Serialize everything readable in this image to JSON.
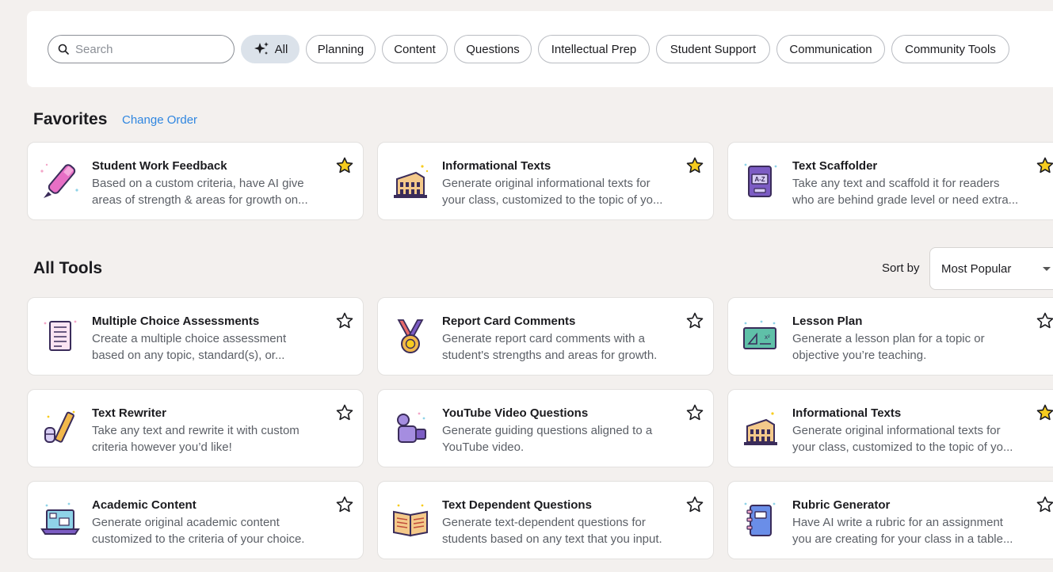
{
  "search": {
    "placeholder": "Search"
  },
  "filters": [
    {
      "label": "All",
      "active": true
    },
    {
      "label": "Planning"
    },
    {
      "label": "Content"
    },
    {
      "label": "Questions"
    },
    {
      "label": "Intellectual Prep"
    },
    {
      "label": "Student Support"
    },
    {
      "label": "Communication"
    },
    {
      "label": "Community Tools"
    }
  ],
  "favorites": {
    "title": "Favorites",
    "change_order": "Change Order",
    "cards": [
      {
        "title": "Student Work Feedback",
        "desc": "Based on a custom criteria, have AI give areas of strength & areas for growth on...",
        "icon": "pen-icon",
        "starred": true
      },
      {
        "title": "Informational Texts",
        "desc": "Generate original informational texts for your class, customized to the topic of yo...",
        "icon": "colosseum-icon",
        "starred": true
      },
      {
        "title": "Text Scaffolder",
        "desc": "Take any text and scaffold it for readers who are behind grade level or need extra...",
        "icon": "dictionary-icon",
        "starred": true
      }
    ]
  },
  "all_tools": {
    "title": "All Tools",
    "sort_label": "Sort by",
    "sort_value": "Most Popular",
    "cards": [
      {
        "title": "Multiple Choice Assessments",
        "desc": "Create a multiple choice assessment based on any topic, standard(s), or...",
        "icon": "checklist-icon",
        "starred": false
      },
      {
        "title": "Report Card Comments",
        "desc": "Generate report card comments with a student's strengths and areas for growth.",
        "icon": "medal-icon",
        "starred": false
      },
      {
        "title": "Lesson Plan",
        "desc": "Generate a lesson plan for a topic or objective you’re teaching.",
        "icon": "chalkboard-icon",
        "starred": false
      },
      {
        "title": "Text Rewriter",
        "desc": "Take any text and rewrite it with custom criteria however you’d like!",
        "icon": "pencil-eraser-icon",
        "starred": false
      },
      {
        "title": "YouTube Video Questions",
        "desc": "Generate guiding questions aligned to a YouTube video.",
        "icon": "video-camera-icon",
        "starred": false
      },
      {
        "title": "Informational Texts",
        "desc": "Generate original informational texts for your class, customized to the topic of yo...",
        "icon": "colosseum-icon",
        "starred": true
      },
      {
        "title": "Academic Content",
        "desc": "Generate original academic content customized to the criteria of your choice.",
        "icon": "laptop-icon",
        "starred": false
      },
      {
        "title": "Text Dependent Questions",
        "desc": "Generate text-dependent questions for students based on any text that you input.",
        "icon": "open-book-icon",
        "starred": false
      },
      {
        "title": "Rubric Generator",
        "desc": "Have AI write a rubric for an assignment you are creating for your class in a table...",
        "icon": "notebook-icon",
        "starred": false
      }
    ]
  },
  "colors": {
    "star_fill": "#f7cc1e",
    "link": "#2f86e0",
    "active_chip": "#dbe2ea",
    "icon_purple": "#7c5cc4",
    "icon_pink": "#e76fc5"
  }
}
